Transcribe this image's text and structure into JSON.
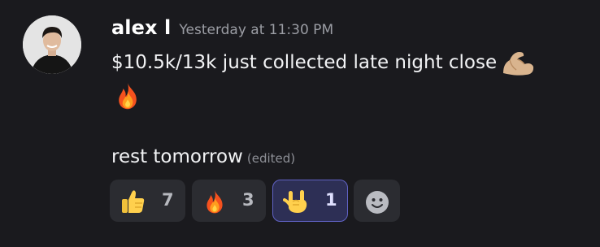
{
  "message": {
    "author": "alex l",
    "timestamp": "Yesterday at 11:30 PM",
    "line1_text": "$10.5k/13k just collected late night close",
    "line1_emojis": [
      "flexed-biceps-emoji",
      "fire-emoji"
    ],
    "line2_text": "rest tomorrow",
    "edited_label": "(edited)"
  },
  "reactions": [
    {
      "emoji": "thumbs-up-emoji",
      "count": "7",
      "selected": false
    },
    {
      "emoji": "fire-emoji",
      "count": "3",
      "selected": false
    },
    {
      "emoji": "rock-on-emoji",
      "count": "1",
      "selected": true
    }
  ],
  "add_reaction_icon": "smiley-face-icon",
  "colors": {
    "background": "#1a1a1e",
    "reaction_bg": "#2b2c31",
    "reaction_selected_bg": "#2d2f55",
    "reaction_selected_border": "#6062c4",
    "timestamp": "#9b9da4",
    "text": "#f2f3f5"
  }
}
